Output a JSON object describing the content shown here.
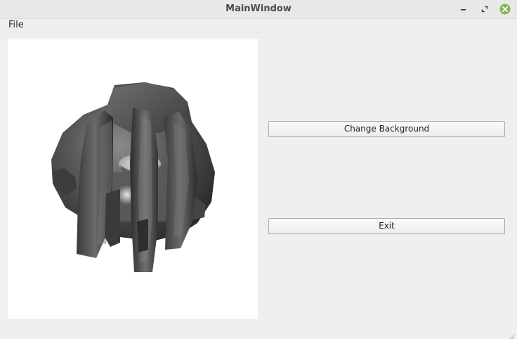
{
  "window": {
    "title": "MainWindow",
    "controls": {
      "minimize_icon": "minimize-icon",
      "maximize_icon": "restore-icon",
      "close_icon": "close-icon",
      "close_color": "#8ab356"
    }
  },
  "menubar": {
    "items": [
      {
        "label": "File"
      }
    ]
  },
  "viewport": {
    "background": "#ffffff",
    "content": "3d-rendered-mesh"
  },
  "buttons": {
    "change_background": "Change Background",
    "exit": "Exit"
  }
}
